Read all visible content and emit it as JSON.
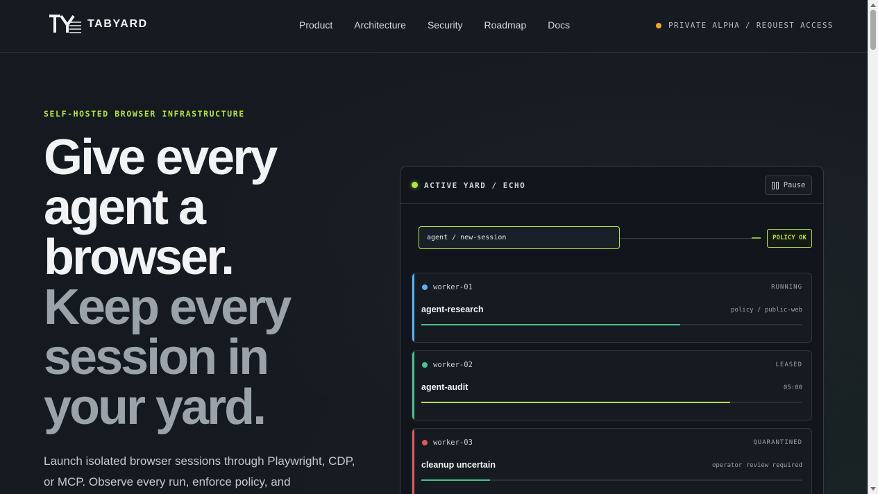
{
  "header": {
    "logo_text": "TABYARD",
    "nav": [
      "Product",
      "Architecture",
      "Security",
      "Roadmap",
      "Docs"
    ],
    "cta": "PRIVATE ALPHA / REQUEST ACCESS",
    "cta_dot_color": "#f0a62e"
  },
  "hero": {
    "eyebrow": "SELF-HOSTED BROWSER INFRASTRUCTURE",
    "headline_primary": [
      "Give every",
      "agent a",
      "browser."
    ],
    "headline_secondary": [
      "Keep every",
      "session in",
      "your yard."
    ],
    "lede": "Launch isolated browser sessions through Playwright, CDP, or MCP. Observe every run, enforce policy, and"
  },
  "panel": {
    "title": "ACTIVE YARD / ECHO",
    "pause_label": "Pause",
    "session_value": "agent / new-session",
    "policy_badge": "POLICY OK",
    "accent_color": "#b4e63c",
    "workers": [
      {
        "id": "worker-01",
        "status": "RUNNING",
        "name": "agent-research",
        "meta": "policy / public-web",
        "color": "#5ab4f0",
        "fill_color": "#4cc38a",
        "progress": 0.68
      },
      {
        "id": "worker-02",
        "status": "LEASED",
        "name": "agent-audit",
        "meta": "05:00",
        "color": "#4cc38a",
        "fill_color": "#b4e63c",
        "progress": 0.81
      },
      {
        "id": "worker-03",
        "status": "QUARANTINED",
        "name": "cleanup uncertain",
        "meta": "operator review required",
        "color": "#e05a5a",
        "fill_color": "#4cc38a",
        "progress": 0.18
      }
    ]
  }
}
